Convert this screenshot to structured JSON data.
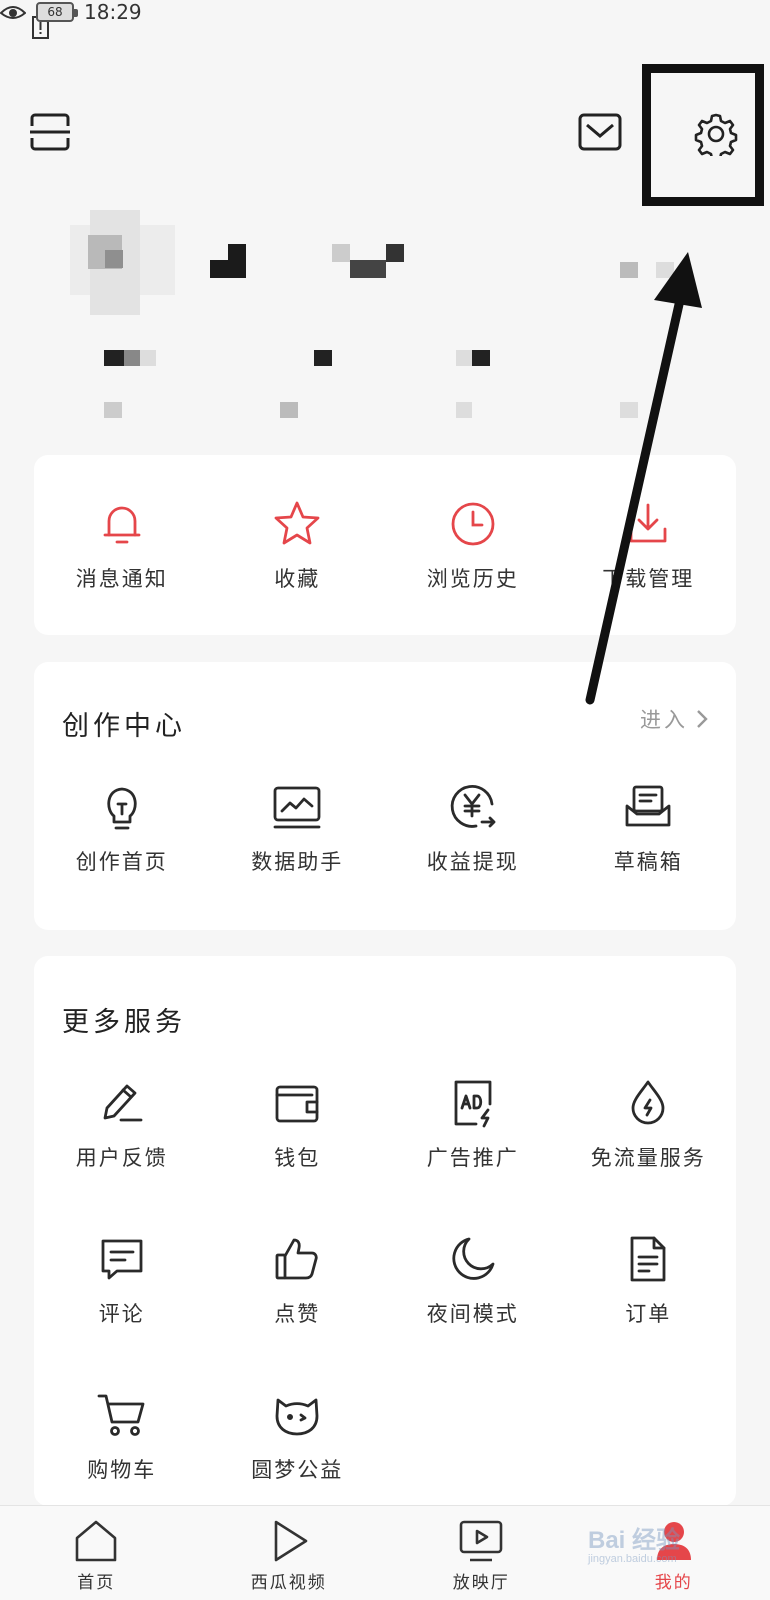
{
  "status_bar": {
    "time": "18:29",
    "battery": "68"
  },
  "quick_actions": [
    {
      "label": "消息通知",
      "icon": "bell-icon"
    },
    {
      "label": "收藏",
      "icon": "star-icon"
    },
    {
      "label": "浏览历史",
      "icon": "clock-icon"
    },
    {
      "label": "下载管理",
      "icon": "download-icon"
    }
  ],
  "creator_center": {
    "title": "创作中心",
    "enter_label": "进入",
    "items": [
      {
        "label": "创作首页",
        "icon": "lightbulb-icon"
      },
      {
        "label": "数据助手",
        "icon": "chart-monitor-icon"
      },
      {
        "label": "收益提现",
        "icon": "yuan-coin-icon"
      },
      {
        "label": "草稿箱",
        "icon": "drafts-box-icon"
      }
    ]
  },
  "more_services": {
    "title": "更多服务",
    "items": [
      {
        "label": "用户反馈",
        "icon": "pen-icon"
      },
      {
        "label": "钱包",
        "icon": "wallet-icon"
      },
      {
        "label": "广告推广",
        "icon": "ad-icon"
      },
      {
        "label": "免流量服务",
        "icon": "data-drop-icon"
      },
      {
        "label": "评论",
        "icon": "comment-icon"
      },
      {
        "label": "点赞",
        "icon": "thumbs-up-icon"
      },
      {
        "label": "夜间模式",
        "icon": "moon-icon"
      },
      {
        "label": "订单",
        "icon": "order-doc-icon"
      },
      {
        "label": "购物车",
        "icon": "cart-icon"
      },
      {
        "label": "圆梦公益",
        "icon": "cat-face-icon"
      }
    ]
  },
  "bottom_nav": [
    {
      "label": "首页",
      "icon": "home-icon"
    },
    {
      "label": "西瓜视频",
      "icon": "play-icon"
    },
    {
      "label": "放映厅",
      "icon": "tv-play-icon"
    },
    {
      "label": "我的",
      "icon": "profile-icon",
      "active": true
    }
  ],
  "watermark": {
    "main": "Bai 经验",
    "sub": "jingyan.baidu.com"
  },
  "colors": {
    "accent": "#e5464a",
    "background": "#f6f6f6",
    "card": "#ffffff"
  }
}
